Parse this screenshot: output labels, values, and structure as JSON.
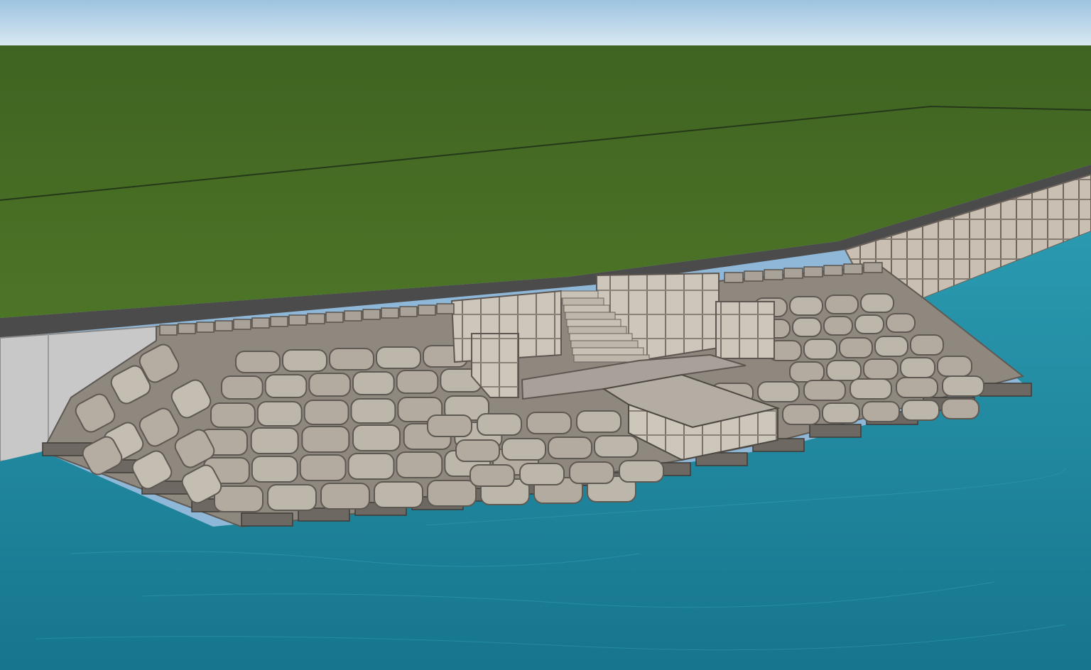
{
  "scene": {
    "kind": "3d-render",
    "elements": [
      "sky",
      "grass-field",
      "paved-road",
      "retaining-wall",
      "stone-revetment",
      "stairs",
      "concrete-platform",
      "water"
    ]
  },
  "colors": {
    "sky_top": "#9cc3e0",
    "sky_bottom": "#d9e8f2",
    "grass": "#4a6f24",
    "grass_dark": "#3e5f1f",
    "road": "#4a4a4a",
    "wall_light": "#cfcac2",
    "wall_dark": "#9c948a",
    "stone": "#bfb8ae",
    "stone_edge": "#6f6a64",
    "concrete": "#b8b0a6",
    "water_light": "#2a9ab0",
    "water_dark": "#1a7a92"
  }
}
